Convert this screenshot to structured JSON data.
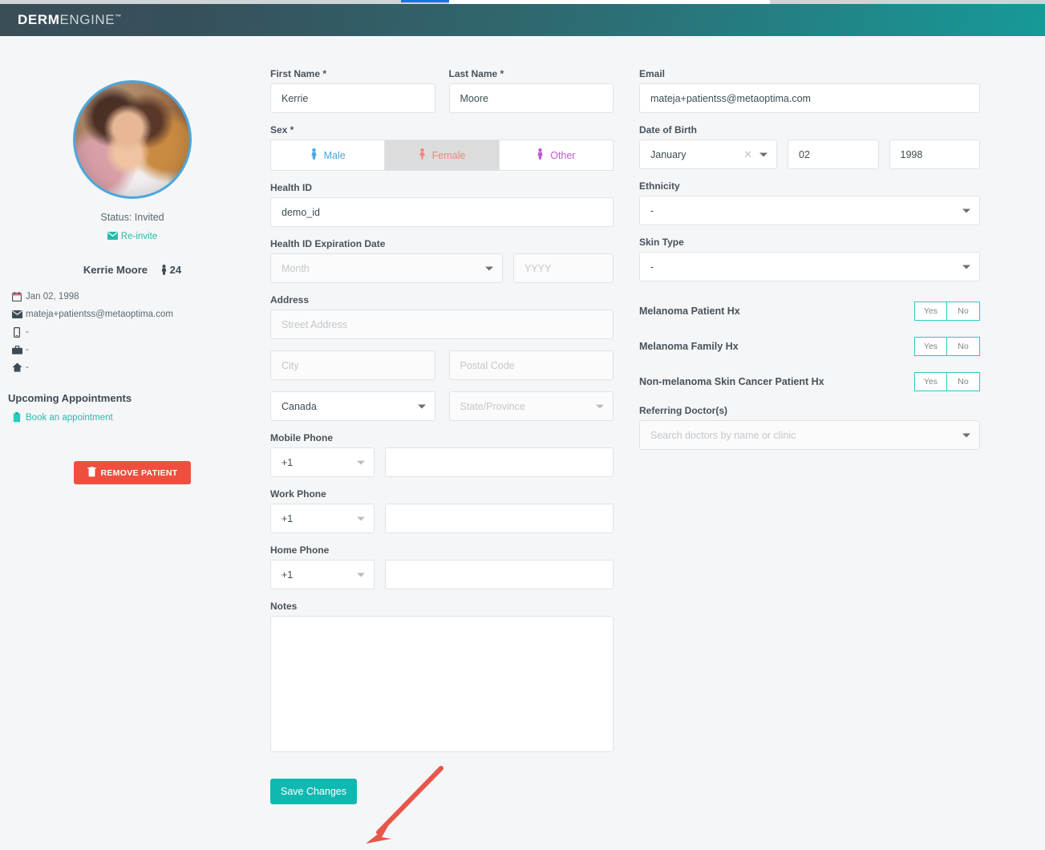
{
  "header": {
    "logo_bold": "DERM",
    "logo_light": "ENGINE",
    "logo_tm": "™"
  },
  "sidebar": {
    "status_label": "Status: Invited",
    "reinvite_label": "Re-invite",
    "patient_name": "Kerrie Moore",
    "age": "24",
    "info": [
      {
        "icon": "calendar-icon",
        "value": "Jan 02, 1998"
      },
      {
        "icon": "envelope-icon",
        "value": "mateja+patientss@metaoptima.com"
      },
      {
        "icon": "mobile-phone-icon",
        "value": "-"
      },
      {
        "icon": "briefcase-icon",
        "value": "-"
      },
      {
        "icon": "home-icon",
        "value": "-"
      }
    ],
    "appointments_heading": "Upcoming Appointments",
    "book_appointment_label": "Book an appointment",
    "remove_patient_label": "REMOVE PATIENT"
  },
  "form": {
    "first_name": {
      "label": "First Name *",
      "value": "Kerrie"
    },
    "last_name": {
      "label": "Last Name *",
      "value": "Moore"
    },
    "sex": {
      "label": "Sex *",
      "options": [
        {
          "label": "Male",
          "selected": false
        },
        {
          "label": "Female",
          "selected": true
        },
        {
          "label": "Other",
          "selected": false
        }
      ]
    },
    "health_id": {
      "label": "Health ID",
      "value": "demo_id"
    },
    "health_id_expiry": {
      "label": "Health ID Expiration Date",
      "month_placeholder": "Month",
      "year_placeholder": "YYYY"
    },
    "address": {
      "label": "Address",
      "street_placeholder": "Street Address",
      "city_placeholder": "City",
      "postal_placeholder": "Postal Code",
      "country_value": "Canada",
      "state_placeholder": "State/Province"
    },
    "mobile_phone": {
      "label": "Mobile Phone",
      "code": "+1",
      "value": ""
    },
    "work_phone": {
      "label": "Work Phone",
      "code": "+1",
      "value": ""
    },
    "home_phone": {
      "label": "Home Phone",
      "code": "+1",
      "value": ""
    },
    "notes": {
      "label": "Notes",
      "value": ""
    },
    "save_label": "Save Changes",
    "email": {
      "label": "Email",
      "value": "mateja+patientss@metaoptima.com"
    },
    "dob": {
      "label": "Date of Birth",
      "month": "January",
      "day": "02",
      "year": "1998"
    },
    "ethnicity": {
      "label": "Ethnicity",
      "value": "-"
    },
    "skin_type": {
      "label": "Skin Type",
      "value": "-"
    },
    "history": [
      {
        "label": "Melanoma Patient Hx",
        "yes": "Yes",
        "no": "No"
      },
      {
        "label": "Melanoma Family Hx",
        "yes": "Yes",
        "no": "No"
      },
      {
        "label": "Non-melanoma Skin Cancer Patient Hx",
        "yes": "Yes",
        "no": "No"
      }
    ],
    "referring_doctors": {
      "label": "Referring Doctor(s)",
      "placeholder": "Search doctors by name or clinic"
    }
  },
  "colors": {
    "accent_teal": "#0fb9b1",
    "danger_red": "#ef4f3f",
    "annotation_red": "#e8564a",
    "male_blue": "#4aa8dd",
    "female_pink": "#f4837c",
    "other_purple": "#c05ad6"
  }
}
